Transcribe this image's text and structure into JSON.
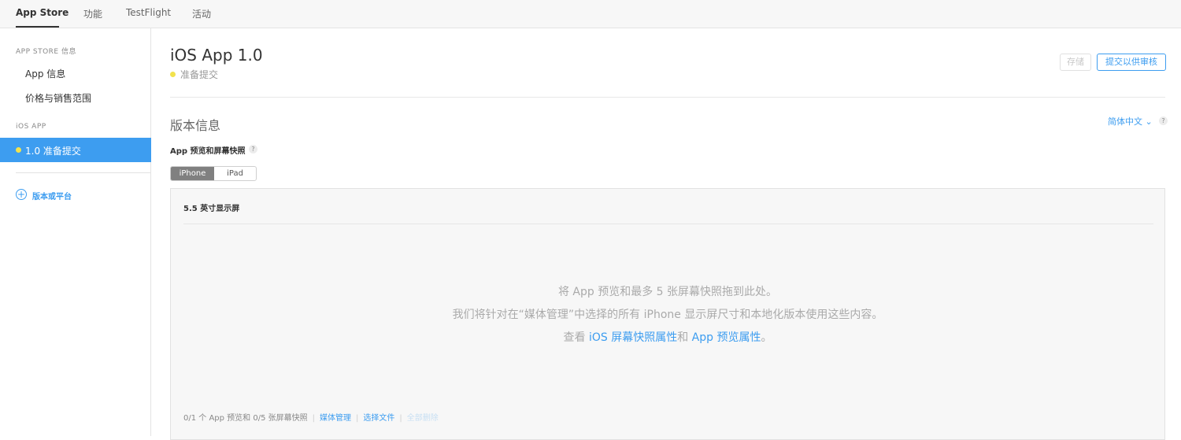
{
  "topnav": {
    "tabs": [
      {
        "label": "App Store",
        "active": true
      },
      {
        "label": "功能",
        "active": false
      },
      {
        "label": "TestFlight",
        "active": false
      },
      {
        "label": "活动",
        "active": false
      }
    ]
  },
  "sidebar": {
    "section1_heading": "APP STORE 信息",
    "items": [
      "App 信息",
      "价格与销售范围"
    ],
    "section2_heading": "iOS APP",
    "selected_item": "1.0 准备提交",
    "add_platform_label": "版本或平台"
  },
  "header": {
    "title": "iOS App 1.0",
    "status": "准备提交",
    "save_label": "存储",
    "submit_label": "提交以供审核"
  },
  "version_info": {
    "title": "版本信息",
    "language": "简体中文 ⌄",
    "help": "?"
  },
  "media": {
    "label": "App 预览和屏幕快照",
    "help": "?",
    "device_tabs": [
      "iPhone",
      "iPad"
    ],
    "selected_device": "iPhone",
    "display_size_label": "5.5 英寸显示屏",
    "drop_line1": "将 App 预览和最多 5 张屏幕快照拖到此处。",
    "drop_line2": "我们将针对在“媒体管理”中选择的所有 iPhone 显示屏尺寸和本地化版本使用这些内容。",
    "drop_line3_prefix": "查看 ",
    "drop_link1": "iOS 屏幕快照属性",
    "drop_line3_middle": "和 ",
    "drop_link2": "App 预览属性",
    "drop_line3_suffix": "。",
    "footer_count": "0/1 个 App 预览和 0/5 张屏幕快照",
    "footer_media_manage": "媒体管理",
    "footer_choose_file": "选择文件",
    "footer_delete_all": "全部删除"
  },
  "colors": {
    "accent": "#3d9df0",
    "status_dot": "#f2e24d",
    "sidebar_selected_bg": "#3d9df0"
  }
}
